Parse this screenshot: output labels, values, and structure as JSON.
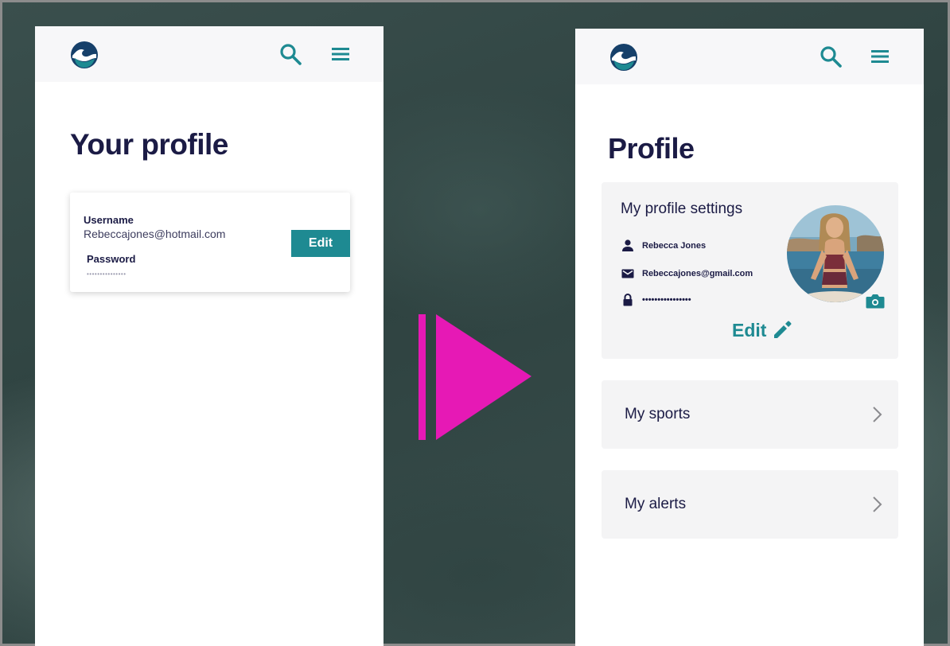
{
  "colors": {
    "accent": "#1e8a92",
    "heading": "#1b1b45",
    "arrow": "#e619b5",
    "card": "#f4f4f5",
    "appbar": "#f7f7f9"
  },
  "before_screen": {
    "title": "Your profile",
    "header_icons": [
      "wave-logo-icon",
      "search-icon",
      "hamburger-menu-icon"
    ],
    "credentials_card": {
      "username_label": "Username",
      "username_value": "Rebeccajones@hotmail.com",
      "password_label": "Password",
      "password_value": "•••••••••••••••",
      "edit_button": "Edit"
    }
  },
  "after_screen": {
    "title": "Profile",
    "header_icons": [
      "wave-logo-icon",
      "search-icon",
      "hamburger-menu-icon"
    ],
    "settings_card": {
      "title": "My profile settings",
      "name": "Rebecca Jones",
      "email": "Rebeccajones@gmail.com",
      "password": "••••••••••••••••",
      "edit_label": "Edit",
      "icons": [
        "person-icon",
        "mail-icon",
        "lock-icon",
        "camera-icon",
        "pencil-icon"
      ]
    },
    "nav_items": [
      {
        "label": "My sports",
        "icon": "chevron-right-icon"
      },
      {
        "label": "My alerts",
        "icon": "chevron-right-icon"
      }
    ]
  },
  "transition_icon": "play-arrow-icon"
}
